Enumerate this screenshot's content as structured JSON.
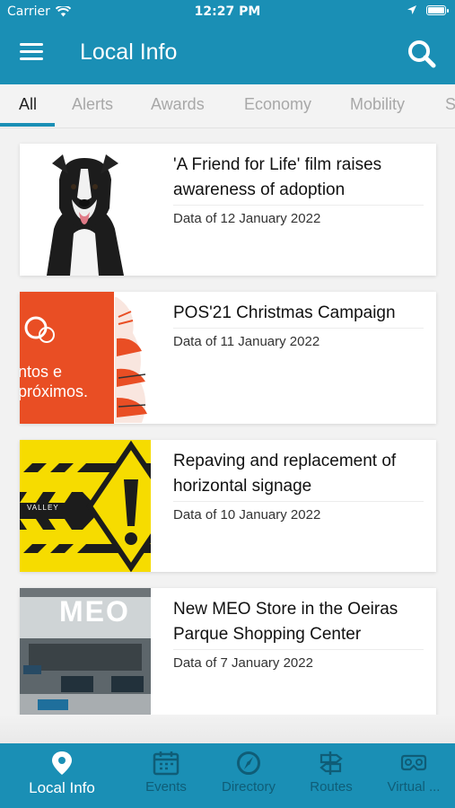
{
  "status_bar": {
    "carrier": "Carrier",
    "time": "12:27 PM"
  },
  "header": {
    "title": "Local Info"
  },
  "tabs": [
    {
      "label": "All"
    },
    {
      "label": "Alerts"
    },
    {
      "label": "Awards"
    },
    {
      "label": "Economy"
    },
    {
      "label": "Mobility"
    },
    {
      "label": "So"
    }
  ],
  "news": [
    {
      "title": "'A Friend for Life' film raises awareness of adoption",
      "date": "Data of 12 January 2022"
    },
    {
      "title": "POS'21 Christmas Campaign",
      "date": "Data of 11 January 2022",
      "image_text": "ntos e próximos."
    },
    {
      "title": "Repaving and replacement of horizontal signage",
      "date": "Data of 10 January 2022",
      "image_text": "VALLEY"
    },
    {
      "title": "New MEO Store in the Oeiras Parque Shopping Center",
      "date": "Data of 7 January 2022",
      "image_text": "MEO"
    }
  ],
  "bottom_nav": [
    {
      "label": "Local Info",
      "icon": "map-pin-icon",
      "active": true
    },
    {
      "label": "Events",
      "icon": "calendar-icon"
    },
    {
      "label": "Directory",
      "icon": "compass-icon"
    },
    {
      "label": "Routes",
      "icon": "signpost-icon"
    },
    {
      "label": "Virtual ...",
      "icon": "vr-headset-icon"
    }
  ],
  "colors": {
    "primary": "#1a8fb5",
    "inactive_nav": "#0f5d77",
    "christmas_orange": "#e94e24",
    "warning_yellow": "#f6dc00"
  }
}
